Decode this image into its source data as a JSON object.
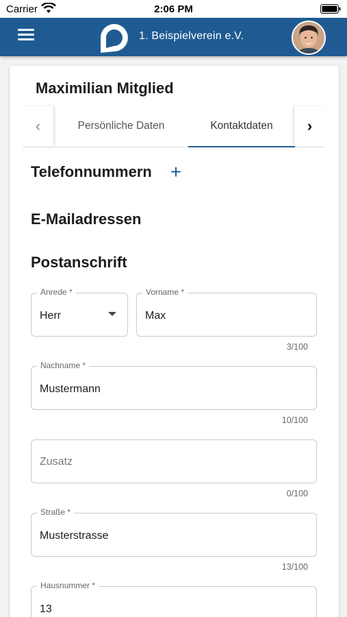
{
  "status_bar": {
    "carrier": "Carrier",
    "time": "2:06 PM"
  },
  "app_bar": {
    "club_name": "1. Beispielverein e.V."
  },
  "member": {
    "name": "Maximilian Mitglied"
  },
  "tabs": [
    {
      "label": "Persönliche Daten",
      "active": false
    },
    {
      "label": "Kontaktdaten",
      "active": true
    }
  ],
  "sections": {
    "phones": "Telefonnummern",
    "emails": "E-Mailadressen",
    "postal": "Postanschrift"
  },
  "form": {
    "salutation": {
      "label": "Anrede *",
      "value": "Herr"
    },
    "first_name": {
      "label": "Vorname *",
      "value": "Max",
      "counter": "3/100"
    },
    "last_name": {
      "label": "Nachname *",
      "value": "Mustermann",
      "counter": "10/100"
    },
    "addition": {
      "placeholder": "Zusatz",
      "counter": "0/100"
    },
    "street": {
      "label": "Straße *",
      "value": "Musterstrasse",
      "counter": "13/100"
    },
    "house_number": {
      "label": "Hausnummer *",
      "value": "13"
    }
  },
  "colors": {
    "primary": "#1f5b92",
    "background": "#f2f2f2"
  }
}
